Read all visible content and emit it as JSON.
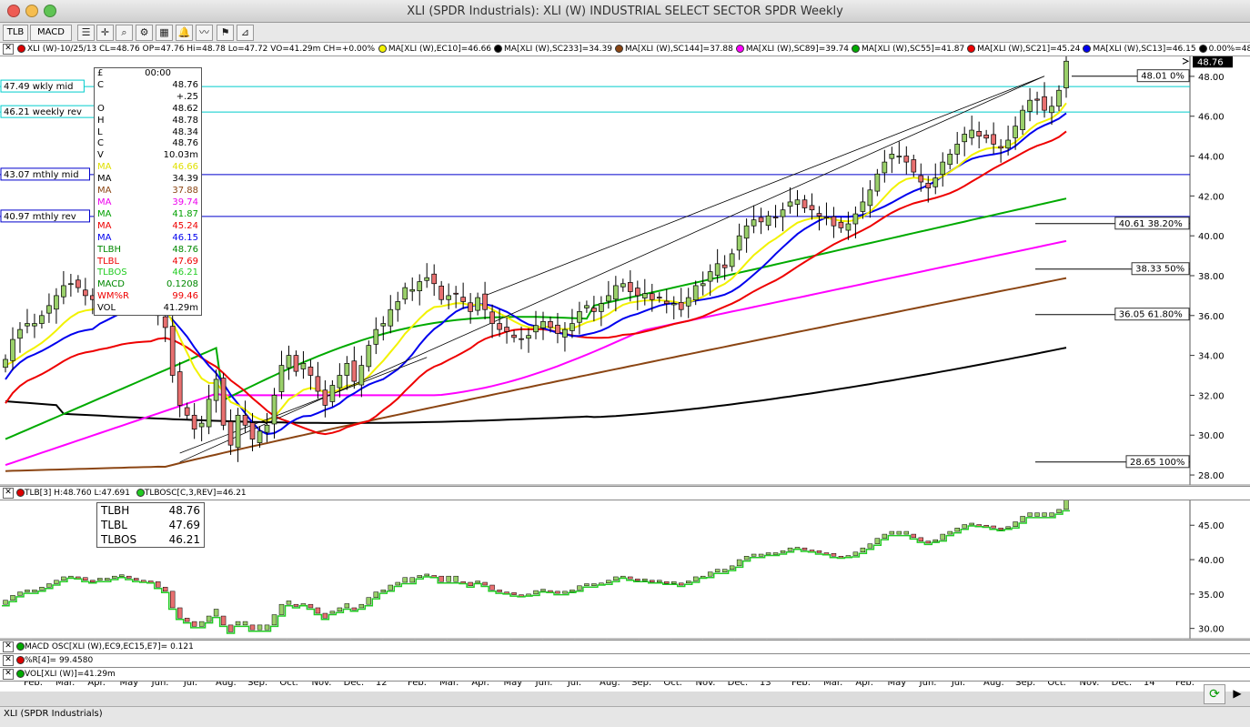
{
  "window": {
    "title": "XLI (SPDR Industrials): XLI (W) INDUSTRIAL SELECT SECTOR SPDR Weekly"
  },
  "toolbar": {
    "tab1": "TLB",
    "tab2": "MACD"
  },
  "legend": {
    "main": "XLI (W)-10/25/13 CL=48.76 OP=47.76 Hi=48.78 Lo=47.72 VO=41.29m CH=+0.00%",
    "items": [
      {
        "text": "MA[XLI (W),EC10]=46.66",
        "color": "#f2f200"
      },
      {
        "text": "MA[XLI (W),SC233]=34.39",
        "color": "#000000"
      },
      {
        "text": "MA[XLI (W),SC144]=37.88",
        "color": "#8b4513"
      },
      {
        "text": "MA[XLI (W),SC89]=39.74",
        "color": "#ff00ff"
      },
      {
        "text": "MA[XLI (W),SC55]=41.87",
        "color": "#00aa00"
      },
      {
        "text": "MA[XLI (W),SC21]=45.24",
        "color": "#ee0000"
      },
      {
        "text": "MA[XLI (W),SC13]=46.15",
        "color": "#0000ee"
      },
      {
        "text": "0.00%=48",
        "color": "#000000"
      }
    ]
  },
  "data_window": {
    "header": [
      "£",
      "00:00"
    ],
    "rows": [
      {
        "k": "C",
        "v": "48.76",
        "c": "#000"
      },
      {
        "k": "",
        "v": "+.25",
        "c": "#000"
      },
      {
        "k": "O",
        "v": "48.62",
        "c": "#000"
      },
      {
        "k": "H",
        "v": "48.78",
        "c": "#000"
      },
      {
        "k": "L",
        "v": "48.34",
        "c": "#000"
      },
      {
        "k": "C",
        "v": "48.76",
        "c": "#000"
      },
      {
        "k": "V",
        "v": "10.03m",
        "c": "#000"
      },
      {
        "k": "MA",
        "v": "46.66",
        "c": "#e0e000"
      },
      {
        "k": "MA",
        "v": "34.39",
        "c": "#000"
      },
      {
        "k": "MA",
        "v": "37.88",
        "c": "#8b4513"
      },
      {
        "k": "MA",
        "v": "39.74",
        "c": "#ee00ee"
      },
      {
        "k": "MA",
        "v": "41.87",
        "c": "#00a000"
      },
      {
        "k": "MA",
        "v": "45.24",
        "c": "#ee0000"
      },
      {
        "k": "MA",
        "v": "46.15",
        "c": "#0000ee"
      },
      {
        "k": "TLBH",
        "v": "48.76",
        "c": "#008800"
      },
      {
        "k": "TLBL",
        "v": "47.69",
        "c": "#ee0000"
      },
      {
        "k": "TLBOS",
        "v": "46.21",
        "c": "#22cc22"
      },
      {
        "k": "MACD",
        "v": "0.1208",
        "c": "#008800"
      },
      {
        "k": "WM%R",
        "v": "99.46",
        "c": "#ee0000"
      },
      {
        "k": "VOL",
        "v": "41.29m",
        "c": "#000"
      }
    ]
  },
  "h_levels": [
    {
      "label": "47.49 wkly mid",
      "price": 47.49,
      "color": "#00cccc"
    },
    {
      "label": "46.21 weekly rev",
      "price": 46.21,
      "color": "#00cccc"
    },
    {
      "label": "43.07 mthly mid",
      "price": 43.07,
      "color": "#0000cc"
    },
    {
      "label": "40.97 mthly rev",
      "price": 40.97,
      "color": "#0000cc"
    }
  ],
  "fib_levels": [
    {
      "label": "48.01 0%",
      "price": 48.01
    },
    {
      "label": "40.61 38.20%",
      "price": 40.61
    },
    {
      "label": "38.33 50%",
      "price": 38.33
    },
    {
      "label": "36.05 61.80%",
      "price": 36.05
    },
    {
      "label": "28.65 100%",
      "price": 28.65
    }
  ],
  "last_price_label": "48.76",
  "tlb_panel": {
    "legend": "TLB[3] H:48.760 L:47.691",
    "legend2": "TLBOSC[C,3,REV]=46.21",
    "box": [
      {
        "k": "TLBH",
        "v": "48.76"
      },
      {
        "k": "TLBL",
        "v": "47.69"
      },
      {
        "k": "TLBOS",
        "v": "46.21"
      }
    ],
    "axis": [
      "45.00",
      "40.00",
      "35.00",
      "30.00"
    ]
  },
  "macd_label": "MACD OSC[XLI (W),EC9,EC15,E7]= 0.121",
  "willr_label": "%R[4]= 99.4580",
  "vol_label": "VOL[XLI (W)]=41.29m",
  "status": "XLI (SPDR Industrials)",
  "chart_data": {
    "type": "candlestick",
    "title": "XLI (SPDR Industrials): XLI (W) INDUSTRIAL SELECT SECTOR SPDR Weekly",
    "period": "Weekly",
    "ylim": [
      27.5,
      49.0
    ],
    "y_ticks": [
      "48.00",
      "46.00",
      "44.00",
      "42.00",
      "40.00",
      "38.00",
      "36.00",
      "34.00",
      "32.00",
      "30.00",
      "28.00"
    ],
    "x_labels": [
      "Feb.",
      "Mar.",
      "Apr.",
      "May",
      "Jun.",
      "Jul.",
      "Aug.",
      "Sep.",
      "Oct.",
      "Nov.",
      "Dec.",
      "12",
      "Feb.",
      "Mar.",
      "Apr.",
      "May",
      "Jun.",
      "Jul.",
      "Aug.",
      "Sep.",
      "Oct.",
      "Nov.",
      "Dec.",
      "13",
      "Feb.",
      "Mar.",
      "Apr.",
      "May",
      "Jun.",
      "Jul.",
      "Aug.",
      "Sep.",
      "Oct.",
      "Nov.",
      "Dec.",
      "14",
      "Feb."
    ],
    "close_path": [
      33.8,
      34.8,
      35.3,
      35.6,
      35.6,
      36.0,
      36.5,
      37.0,
      37.5,
      37.6,
      37.4,
      37.0,
      36.8,
      37.3,
      37.0,
      37.6,
      37.8,
      37.3,
      37.0,
      36.9,
      36.8,
      36.0,
      35.4,
      33.0,
      31.5,
      31.0,
      30.3,
      30.6,
      31.8,
      32.8,
      30.5,
      29.5,
      31.0,
      30.5,
      29.8,
      30.2,
      30.5,
      32.0,
      33.5,
      34.0,
      33.2,
      33.6,
      33.0,
      32.2,
      31.5,
      32.5,
      33.0,
      33.6,
      32.7,
      33.5,
      34.5,
      35.3,
      35.6,
      36.3,
      36.7,
      37.4,
      37.3,
      37.7,
      37.9,
      37.6,
      36.8,
      37.0,
      37.1,
      36.7,
      36.2,
      36.9,
      36.3,
      35.6,
      35.3,
      35.2,
      34.9,
      34.8,
      35.0,
      35.5,
      35.7,
      35.4,
      35.1,
      35.3,
      35.6,
      36.2,
      36.5,
      36.2,
      36.6,
      37.0,
      37.5,
      37.6,
      37.2,
      37.0,
      37.1,
      36.8,
      36.9,
      36.6,
      36.6,
      36.3,
      36.9,
      37.5,
      37.6,
      38.2,
      38.6,
      38.4,
      39.1,
      40.0,
      40.5,
      40.8,
      40.7,
      41.0,
      40.9,
      41.3,
      41.7,
      41.8,
      41.4,
      41.3,
      41.0,
      40.9,
      40.5,
      40.4,
      40.6,
      41.1,
      41.7,
      42.3,
      43.1,
      43.7,
      44.1,
      44.0,
      43.7,
      43.2,
      42.7,
      42.4,
      42.9,
      43.7,
      44.1,
      44.6,
      45.1,
      45.3,
      45.0,
      44.9,
      44.6,
      44.4,
      44.8,
      45.5,
      46.3,
      46.8,
      46.8,
      46.3,
      46.5,
      47.3,
      48.76
    ],
    "moving_averages": [
      {
        "name": "EC10",
        "value": 46.66,
        "color": "#f2f200"
      },
      {
        "name": "SC13",
        "value": 46.15,
        "color": "#0000ee"
      },
      {
        "name": "SC21",
        "value": 45.24,
        "color": "#ee0000"
      },
      {
        "name": "SC55",
        "value": 41.87,
        "color": "#00aa00"
      },
      {
        "name": "SC89",
        "value": 39.74,
        "color": "#ff00ff"
      },
      {
        "name": "SC144",
        "value": 37.88,
        "color": "#8b4513"
      },
      {
        "name": "SC233",
        "value": 34.39,
        "color": "#000000"
      }
    ],
    "last": {
      "open": 47.76,
      "high": 48.78,
      "low": 47.72,
      "close": 48.76
    }
  },
  "colors": {
    "up": "#9ad06a",
    "down": "#e87070",
    "frame": "#ffffff",
    "grid": "#888888"
  }
}
